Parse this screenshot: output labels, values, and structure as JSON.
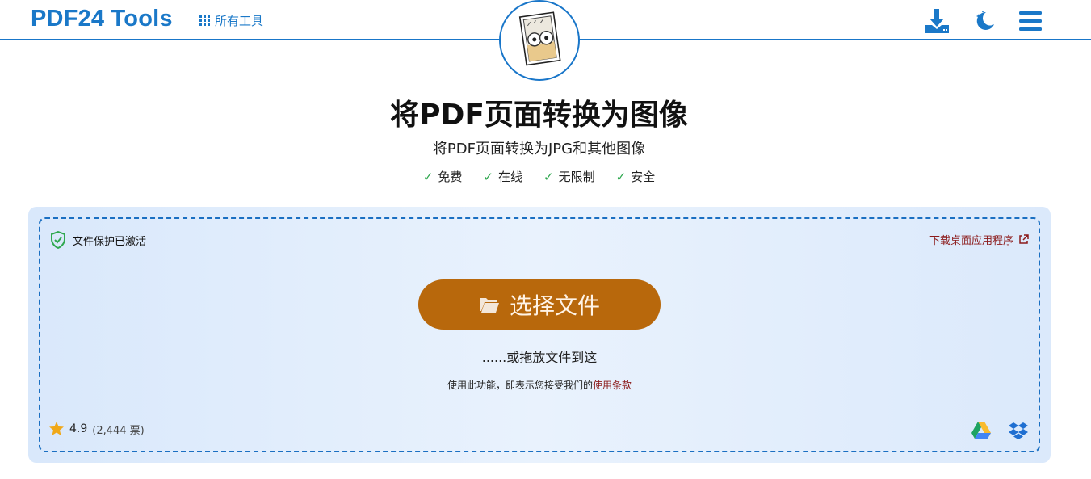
{
  "header": {
    "logo": "PDF24 Tools",
    "all_tools_label": "所有工具",
    "icons": [
      "download-icon",
      "dark-mode-moon-icon",
      "hamburger-menu-icon"
    ]
  },
  "medallion_icon": "pdf-to-image-illustration",
  "hero": {
    "title": "将PDF页面转换为图像",
    "subtitle": "将PDF页面转换为JPG和其他图像",
    "features": [
      "免费",
      "在线",
      "无限制",
      "安全"
    ]
  },
  "dropzone": {
    "protection_label": "文件保护已激活",
    "desktop_link": "下载桌面应用程序",
    "choose_button": "选择文件",
    "drop_hint": "......或拖放文件到这",
    "terms_prefix": "使用此功能，即表示您接受我们的",
    "terms_link": "使用条款",
    "rating_value": "4.9",
    "rating_votes": "(2,444 票)",
    "cloud_sources": [
      "google-drive-icon",
      "dropbox-icon"
    ]
  },
  "colors": {
    "brand_blue": "#1a78c8",
    "button_orange": "#b8680c",
    "link_red": "#8b1a1a",
    "check_green": "#2fa84f",
    "star_gold": "#f0a818"
  }
}
